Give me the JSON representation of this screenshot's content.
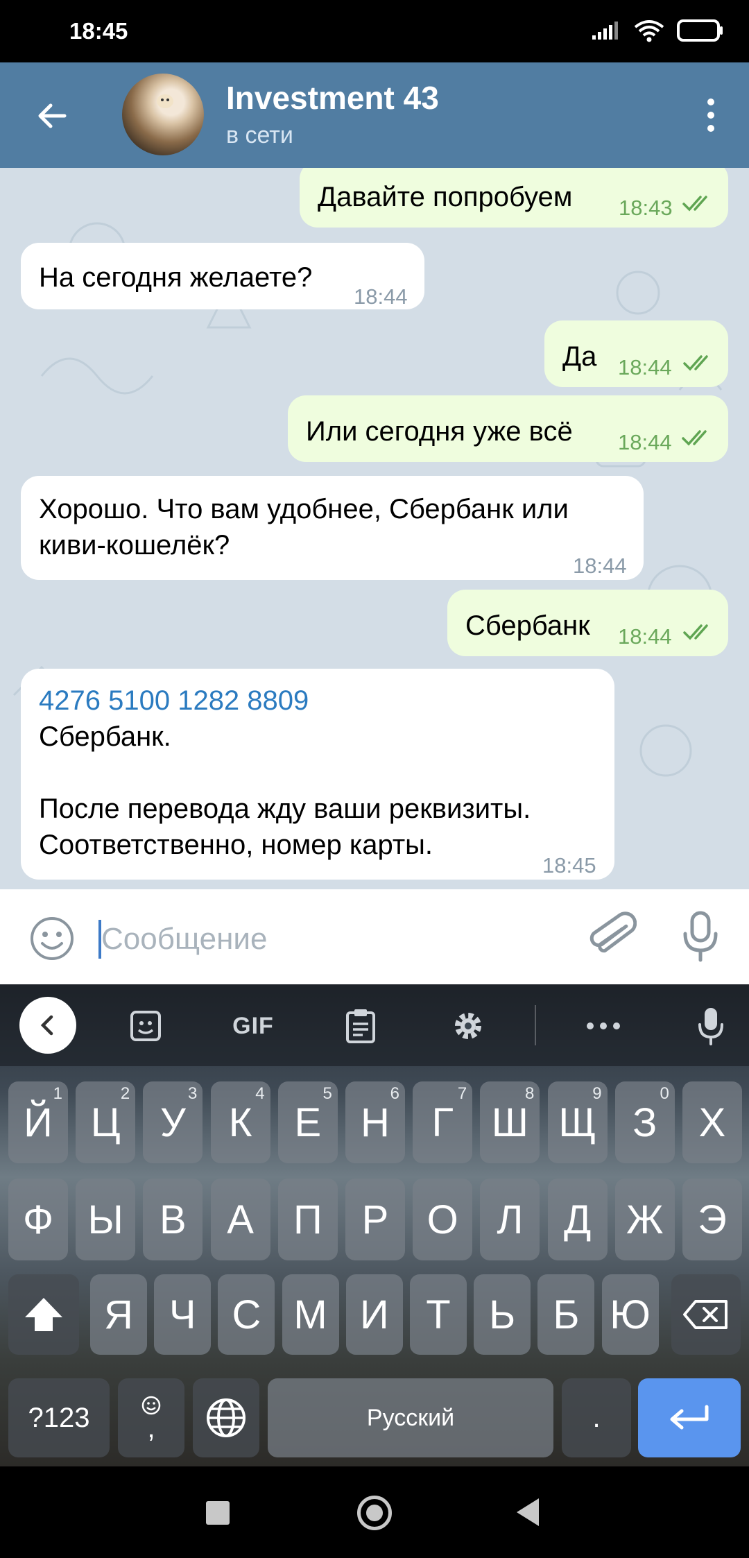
{
  "status_bar": {
    "time": "18:45"
  },
  "header": {
    "title": "Investment 43",
    "subtitle": "в сети"
  },
  "messages": [
    {
      "dir": "out",
      "text": "Давайте попробуем",
      "time": "18:43"
    },
    {
      "dir": "in",
      "text": "На сегодня желаете?",
      "time": "18:44"
    },
    {
      "dir": "out",
      "text": "Да",
      "time": "18:44"
    },
    {
      "dir": "out",
      "text": "Или сегодня уже всё",
      "time": "18:44"
    },
    {
      "dir": "in",
      "lines": [
        "Хорошо. Что вам удобнее, Сбербанк или",
        "киви-кошелёк?"
      ],
      "time": "18:44"
    },
    {
      "dir": "out",
      "text": "Сбербанк",
      "time": "18:44"
    },
    {
      "dir": "in",
      "link": "4276 5100 1282 8809",
      "lines": [
        "Сбербанк.",
        "",
        "После перевода жду ваши реквизиты.",
        "Соответственно, номер карты."
      ],
      "time": "18:45"
    }
  ],
  "input": {
    "placeholder": "Сообщение"
  },
  "keyboard": {
    "toolbar": {
      "gif_label": "GIF"
    },
    "row1": [
      {
        "k": "Й",
        "h": "1"
      },
      {
        "k": "Ц",
        "h": "2"
      },
      {
        "k": "У",
        "h": "3"
      },
      {
        "k": "К",
        "h": "4"
      },
      {
        "k": "Е",
        "h": "5"
      },
      {
        "k": "Н",
        "h": "6"
      },
      {
        "k": "Г",
        "h": "7"
      },
      {
        "k": "Ш",
        "h": "8"
      },
      {
        "k": "Щ",
        "h": "9"
      },
      {
        "k": "З",
        "h": "0"
      },
      {
        "k": "Х",
        "h": ""
      }
    ],
    "row2": [
      "Ф",
      "Ы",
      "В",
      "А",
      "П",
      "Р",
      "О",
      "Л",
      "Д",
      "Ж",
      "Э"
    ],
    "row3": [
      "Я",
      "Ч",
      "С",
      "М",
      "И",
      "Т",
      "Ь",
      "Б",
      "Ю"
    ],
    "row4": {
      "symbols": "?123",
      "emoji_comma": ",",
      "space": "Русский",
      "period": "."
    }
  },
  "icons": {
    "back": "arrow-left-icon",
    "menu": "more-vertical-icon",
    "emoji": "smile-icon",
    "attach": "paperclip-icon",
    "mic": "microphone-icon",
    "signal": "signal-icon",
    "wifi": "wifi-icon",
    "battery": "battery-icon"
  },
  "colors": {
    "header": "#517da2",
    "outgoing_bubble": "#effdde",
    "incoming_bubble": "#ffffff",
    "link": "#2b7bc0",
    "enter_key": "#5a95ee"
  }
}
